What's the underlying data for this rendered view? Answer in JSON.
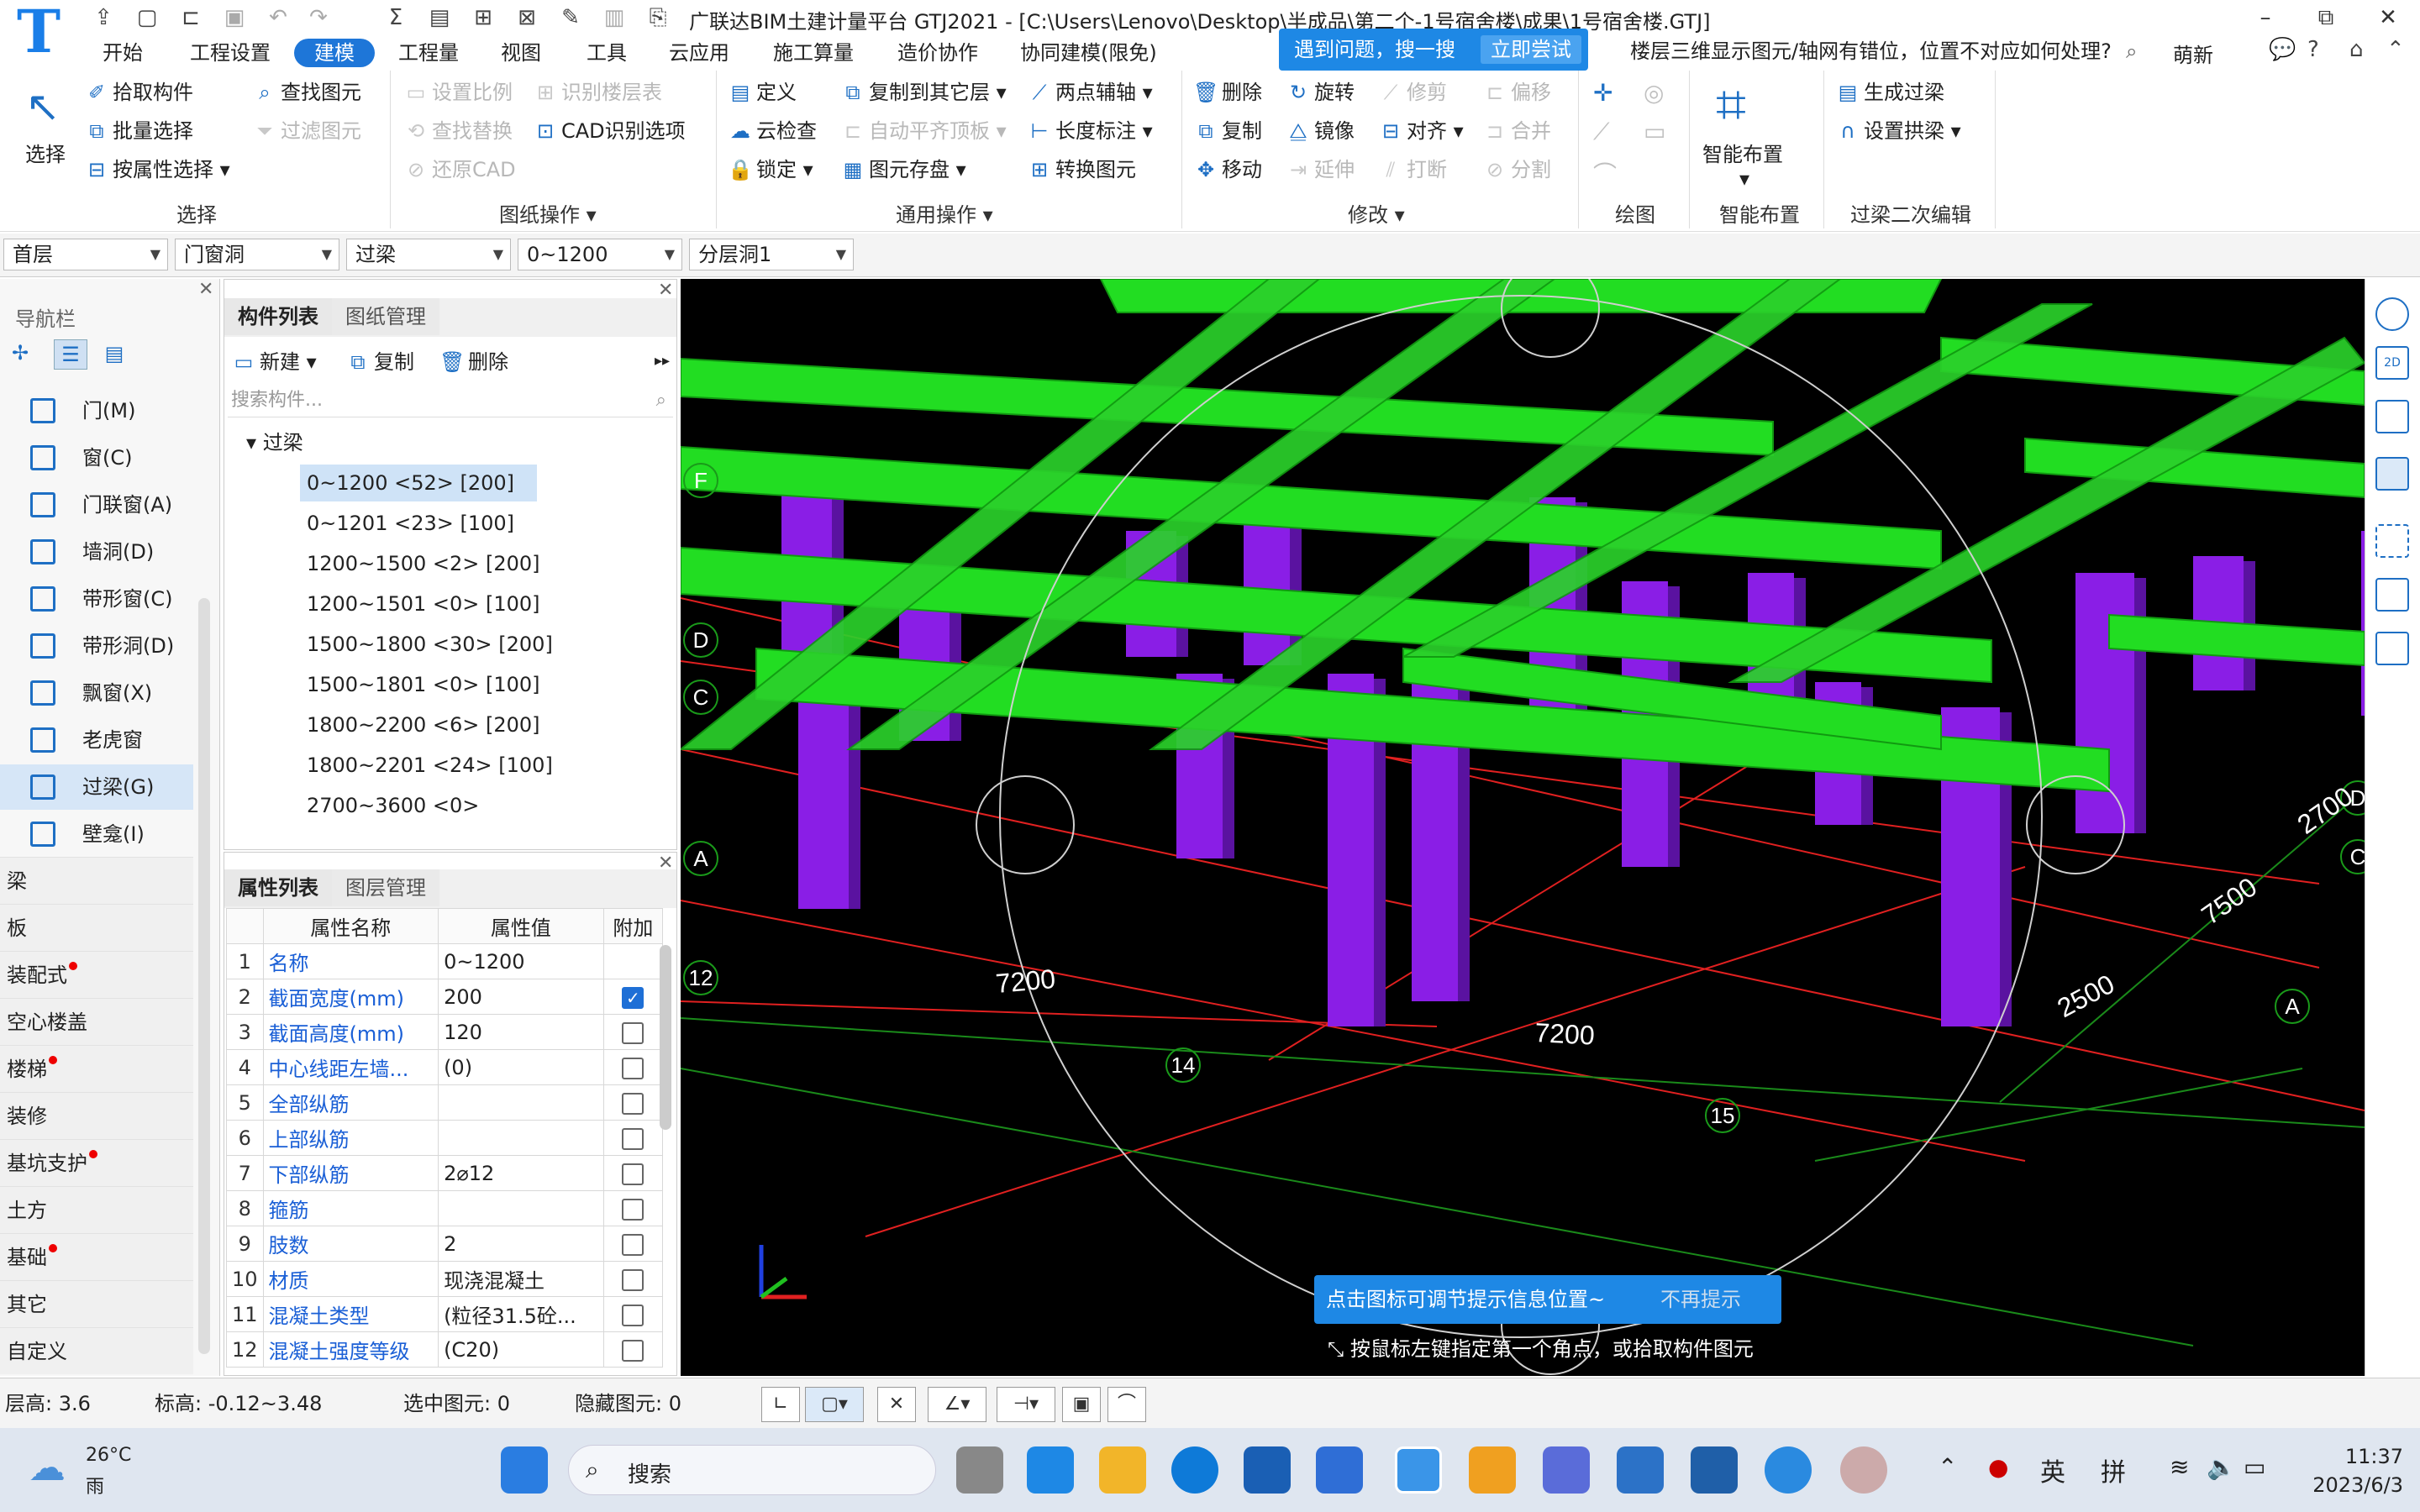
{
  "title_bar": {
    "app_title": "广联达BIM土建计量平台 GTJ2021 - [C:\\Users\\Lenovo\\Desktop\\半成品\\第二个-1号宿舍楼\\成果\\1号宿舍楼.GTJ]",
    "minimize": "–",
    "restore": "⧉",
    "close": "✕"
  },
  "menu": {
    "items": [
      "开始",
      "工程设置",
      "建模",
      "工程量",
      "视图",
      "工具",
      "云应用",
      "施工算量",
      "造价协作",
      "协同建模(限免)"
    ],
    "active": "建模"
  },
  "help_popup": {
    "text": "遇到问题，搜一搜",
    "button": "立即尝试"
  },
  "help_search": {
    "query": "楼层三维显示图元/轴网有错位，位置不对应如何处理?",
    "user": "萌新"
  },
  "ribbon": {
    "select_group": {
      "select": "选择",
      "pick": "拾取构件",
      "batch": "批量选择",
      "by_attr": "按属性选择",
      "find": "查找图元",
      "filter": "过滤图元",
      "label": "选择"
    },
    "drawing_group": {
      "set_scale": "设置比例",
      "recognize_floor": "识别楼层表",
      "find_replace": "查找替换",
      "cad_options": "CAD识别选项",
      "restore_cad": "还原CAD",
      "label": "图纸操作"
    },
    "common_group": {
      "define": "定义",
      "copy_to_other": "复制到其它层",
      "two_point_axis": "两点辅轴",
      "cloud_check": "云检查",
      "auto_slab": "自动平齐顶板",
      "length_dim": "长度标注",
      "lock": "锁定",
      "save_elem": "图元存盘",
      "convert": "转换图元",
      "label": "通用操作"
    },
    "modify_group": {
      "delete": "删除",
      "rotate": "旋转",
      "trim": "修剪",
      "offset": "偏移",
      "copy": "复制",
      "mirror": "镜像",
      "align": "对齐",
      "merge": "合并",
      "move": "移动",
      "extend": "延伸",
      "break": "打断",
      "split": "分割",
      "label": "修改"
    },
    "draw_group": {
      "label": "绘图"
    },
    "smart_group": {
      "button": "智能布置",
      "label": "智能布置"
    },
    "lintel_group": {
      "generate": "生成过梁",
      "arch": "设置拱梁",
      "label": "过梁二次编辑"
    }
  },
  "filters": {
    "floor": "首层",
    "category": "门窗洞",
    "type": "过梁",
    "component": "0~1200",
    "layer": "分层洞1"
  },
  "nav": {
    "title": "导航栏",
    "items": [
      "门(M)",
      "窗(C)",
      "门联窗(A)",
      "墙洞(D)",
      "带形窗(C)",
      "带形洞(D)",
      "飘窗(X)",
      "老虎窗",
      "过梁(G)",
      "壁龛(I)"
    ],
    "selected": "过梁(G)",
    "categories": [
      "梁",
      "板",
      "装配式",
      "空心楼盖",
      "楼梯",
      "装修",
      "基坑支护",
      "土方",
      "基础",
      "其它",
      "自定义"
    ],
    "dot_categories": [
      "装配式",
      "楼梯",
      "基坑支护",
      "基础"
    ]
  },
  "component_panel": {
    "tabs": [
      "构件列表",
      "图纸管理"
    ],
    "new": "新建",
    "copy": "复制",
    "delete": "删除",
    "search_placeholder": "搜索构件...",
    "root": "过梁",
    "items": [
      "0~1200 <52> [200]",
      "0~1201 <23> [100]",
      "1200~1500 <2> [200]",
      "1200~1501 <0> [100]",
      "1500~1800 <30> [200]",
      "1500~1801 <0> [100]",
      "1800~2200 <6> [200]",
      "1800~2201 <24> [100]",
      "2700~3600 <0>"
    ],
    "selected_index": 0
  },
  "property_panel": {
    "tabs": [
      "属性列表",
      "图层管理"
    ],
    "headers": [
      "属性名称",
      "属性值",
      "附加"
    ],
    "rows": [
      {
        "no": "1",
        "name": "名称",
        "value": "0~1200",
        "check": null
      },
      {
        "no": "2",
        "name": "截面宽度(mm)",
        "value": "200",
        "check": true
      },
      {
        "no": "3",
        "name": "截面高度(mm)",
        "value": "120",
        "check": false
      },
      {
        "no": "4",
        "name": "中心线距左墙...",
        "value": "(0)",
        "check": false
      },
      {
        "no": "5",
        "name": "全部纵筋",
        "value": "",
        "check": false
      },
      {
        "no": "6",
        "name": "上部纵筋",
        "value": "",
        "check": false
      },
      {
        "no": "7",
        "name": "下部纵筋",
        "value": "2⌀12",
        "check": false
      },
      {
        "no": "8",
        "name": "箍筋",
        "value": "",
        "check": false
      },
      {
        "no": "9",
        "name": "肢数",
        "value": "2",
        "check": false
      },
      {
        "no": "10",
        "name": "材质",
        "value": "现浇混凝土",
        "check": false
      },
      {
        "no": "11",
        "name": "混凝土类型",
        "value": "(粒径31.5砼...",
        "check": false
      },
      {
        "no": "12",
        "name": "混凝土强度等级",
        "value": "(C20)",
        "check": false
      }
    ]
  },
  "viewport": {
    "axis_labels": [
      "F",
      "D",
      "C",
      "A",
      "12",
      "14",
      "15",
      "A",
      "C",
      "D"
    ],
    "dims": [
      "7200",
      "7200",
      "2500",
      "7500",
      "2700"
    ],
    "tip": "点击图标可调节提示信息位置~",
    "tip_dismiss": "不再提示",
    "hint": "按鼠标左键指定第一个角点，或拾取构件图元",
    "beam_color": "#22dd22",
    "column_color": "#8a1ee6",
    "axis_color": "#e02020"
  },
  "status_bar": {
    "floor_height": "层高:  3.6",
    "elevation": "标高:  -0.12~3.48",
    "selected": "选中图元:  0",
    "hidden": "隐藏图元:  0"
  },
  "taskbar": {
    "weather_temp": "26°C",
    "weather_desc": "雨",
    "search": "搜索",
    "ime1": "英",
    "ime2": "拼",
    "time": "11:37",
    "date": "2023/6/3"
  }
}
